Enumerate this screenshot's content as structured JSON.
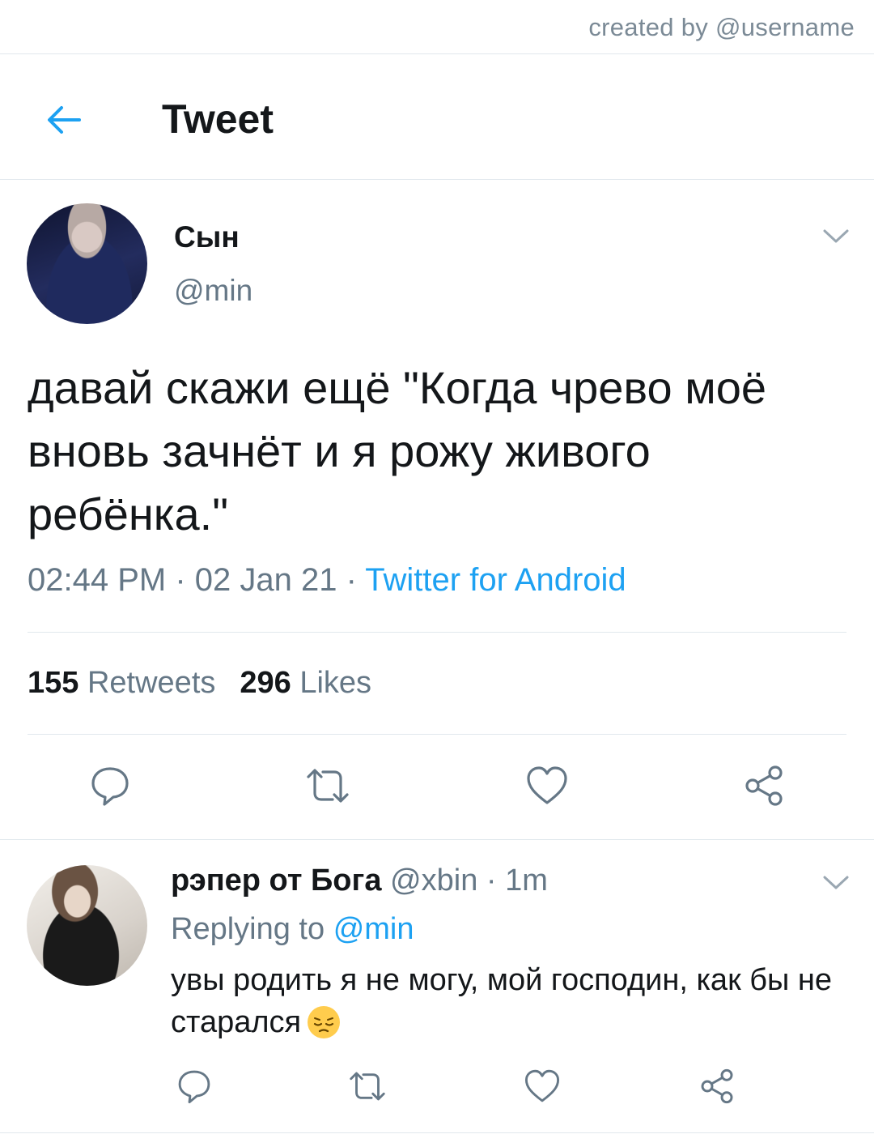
{
  "watermark": "created by @username",
  "header": {
    "title": "Tweet",
    "back_icon": "arrow-left-icon"
  },
  "tweet": {
    "display_name": "Сын",
    "handle": "@min",
    "text": "давай скажи ещё \"Когда чрево моё вновь зачнёт и я рожу живого ребёнка.\"",
    "time": "02:44 PM",
    "date": "02 Jan 21",
    "separator": " · ",
    "source": "Twitter for Android",
    "retweets_count": "155",
    "retweets_label": "Retweets",
    "likes_count": "296",
    "likes_label": "Likes",
    "actions": [
      "reply-icon",
      "retweet-icon",
      "like-icon",
      "share-icon"
    ]
  },
  "reply": {
    "display_name": "рэпер от Бога",
    "handle": "@xbin",
    "time": "1m",
    "separator": " · ",
    "replying_label": "Replying to",
    "replying_to": "@min",
    "text": "увы родить я не могу, мой господин, как бы не старался",
    "emoji": "pensive-face-emoji",
    "actions": [
      "reply-icon",
      "retweet-icon",
      "like-icon",
      "share-icon"
    ]
  },
  "colors": {
    "accent": "#1da1f2",
    "secondary_text": "#657786",
    "primary_text": "#14171a",
    "divider": "#e1e8ed"
  }
}
